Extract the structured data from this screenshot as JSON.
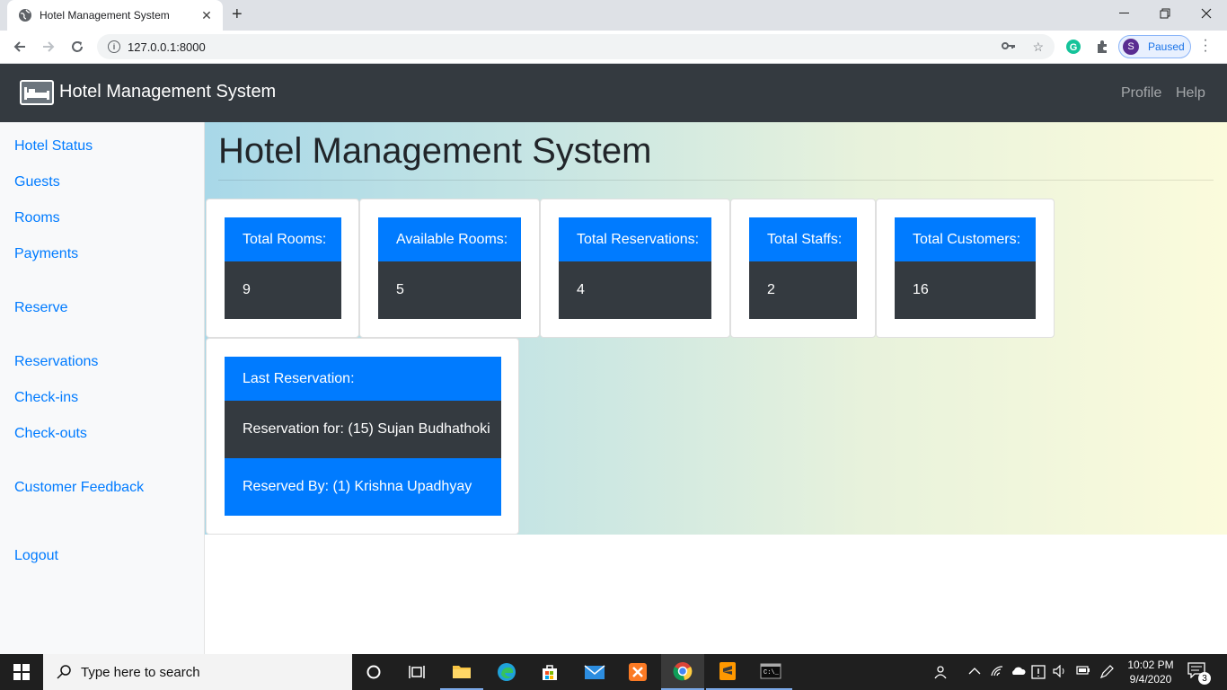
{
  "browser": {
    "tab_title": "Hotel Management System",
    "url": "127.0.0.1:8000",
    "profile_initial": "S",
    "profile_status": "Paused"
  },
  "navbar": {
    "brand": "Hotel Management System",
    "links": [
      "Profile",
      "Help"
    ]
  },
  "sidebar": {
    "items": [
      {
        "label": "Hotel Status"
      },
      {
        "label": "Guests"
      },
      {
        "label": "Rooms"
      },
      {
        "label": "Payments"
      },
      {
        "label": "Reserve"
      },
      {
        "label": "Reservations"
      },
      {
        "label": "Check-ins"
      },
      {
        "label": "Check-outs"
      },
      {
        "label": "Customer Feedback"
      },
      {
        "label": "Logout"
      }
    ]
  },
  "main": {
    "title": "Hotel Management System",
    "stats": [
      {
        "label": "Total Rooms:",
        "value": "9"
      },
      {
        "label": "Available Rooms:",
        "value": "5"
      },
      {
        "label": "Total Reservations:",
        "value": "4"
      },
      {
        "label": "Total Staffs:",
        "value": "2"
      },
      {
        "label": "Total Customers:",
        "value": "16"
      }
    ],
    "last_reservation": {
      "header": "Last Reservation:",
      "reservation_for": "Reservation for: (15) Sujan Budhathoki",
      "reserved_by": "Reserved By: (1) Krishna Upadhyay"
    }
  },
  "taskbar": {
    "search_placeholder": "Type here to search",
    "time": "10:02 PM",
    "date": "9/4/2020",
    "notification_count": "3"
  },
  "colors": {
    "primary": "#007bff",
    "dark": "#343a40",
    "link": "#007bff"
  }
}
